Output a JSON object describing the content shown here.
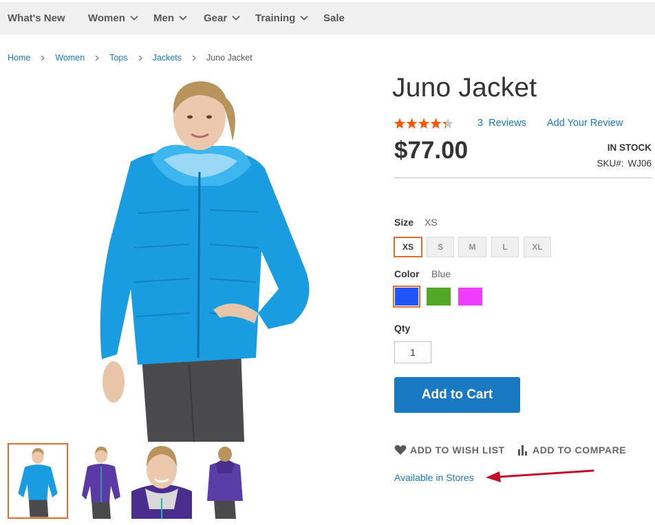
{
  "nav": {
    "items": [
      {
        "label": "What's New",
        "has_dropdown": false
      },
      {
        "label": "Women",
        "has_dropdown": true
      },
      {
        "label": "Men",
        "has_dropdown": true
      },
      {
        "label": "Gear",
        "has_dropdown": true
      },
      {
        "label": "Training",
        "has_dropdown": true
      },
      {
        "label": "Sale",
        "has_dropdown": false
      }
    ]
  },
  "breadcrumbs": {
    "links": [
      "Home",
      "Women",
      "Tops",
      "Jackets"
    ],
    "current": "Juno Jacket"
  },
  "product": {
    "title": "Juno Jacket",
    "rating_stars": 4.3,
    "rating_max": 5,
    "reviews_count": "3",
    "reviews_label": "Reviews",
    "add_review": "Add Your Review",
    "price": "$77.00",
    "stock": "In stock",
    "sku_label": "SKU#:",
    "sku": "WJ06",
    "jacket_color": "#1a9ce0"
  },
  "size": {
    "label": "Size",
    "selected": "XS",
    "options": [
      "XS",
      "S",
      "M",
      "L",
      "XL"
    ]
  },
  "color": {
    "label": "Color",
    "selected": "Blue",
    "options": [
      {
        "name": "Blue",
        "hex": "#1f55f7"
      },
      {
        "name": "Green",
        "hex": "#53a828"
      },
      {
        "name": "Purple",
        "hex": "#ef3dff"
      }
    ]
  },
  "qty": {
    "label": "Qty",
    "value": "1"
  },
  "actions": {
    "add_to_cart": "Add to Cart",
    "wish_list": "Add to Wish List",
    "compare": "Add to Compare",
    "available_in_stores": "Available in Stores"
  },
  "gallery": {
    "thumbnails": [
      {
        "jacket": "#1a9ce0",
        "active": true
      },
      {
        "jacket": "#5b3aa6",
        "active": false
      },
      {
        "jacket": "#4a2e8e",
        "active": false
      },
      {
        "jacket": "#5a3ea8",
        "active": false
      }
    ]
  },
  "colors": {
    "accent": "#1979c3",
    "selected_border": "#e36b2c",
    "star": "#ff5501",
    "arrow": "#c0112b"
  }
}
